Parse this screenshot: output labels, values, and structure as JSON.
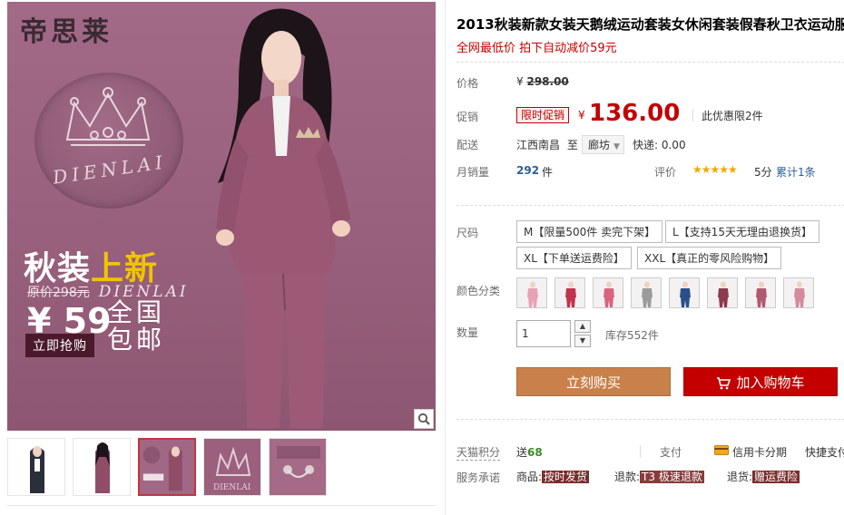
{
  "gallery": {
    "brand": "帝思莱",
    "crown_text": "DIENLAI",
    "promo_title_a": "秋装",
    "promo_title_b": "上新",
    "promo_orig_prefix": "原价298元",
    "promo_orig_en": "DIENLAI",
    "promo_price": "¥ 59",
    "promo_ship": "全国包邮",
    "promo_button": "立即抢购",
    "thumbnails": [
      "thumb-1",
      "thumb-2",
      "thumb-3",
      "thumb-4",
      "thumb-5"
    ],
    "active_thumbnail_index": 2
  },
  "product": {
    "title": "2013秋装新款女装天鹅绒运动套装女休闲套装假春秋卫衣运动服",
    "subtitle": "全网最低价 拍下自动减价59元"
  },
  "price": {
    "label": "价格",
    "currency": "¥",
    "original": "298.00"
  },
  "promo": {
    "label": "促销",
    "badge": "限时促销",
    "currency": "¥",
    "value": "136.00",
    "limit": "此优惠限2件"
  },
  "shipping": {
    "label": "配送",
    "from": "江西南昌",
    "to_word": "至",
    "to": "廊坊",
    "fee": "快递: 0.00"
  },
  "sales": {
    "label": "月销量",
    "count": "292",
    "unit": "件",
    "rating_label": "评价",
    "stars": "★★★★★",
    "score": "5分",
    "total": "累计1条"
  },
  "size": {
    "label": "尺码",
    "options": [
      "M【限量500件 卖完下架】",
      "L【支持15天无理由退换货】",
      "XL【下单送运费险】",
      "XXL【真正的零风险购物】"
    ]
  },
  "colors": {
    "label": "颜色分类",
    "swatches": [
      "#e7a2b6",
      "#c0334f",
      "#d9647f",
      "#9a9a9a",
      "#2a4f8a",
      "#8c3a4e",
      "#b05a70",
      "#d48a9c"
    ]
  },
  "quantity": {
    "label": "数量",
    "value": "1",
    "stock": "库存552件"
  },
  "actions": {
    "buy": "立刻购买",
    "cart": "加入购物车"
  },
  "points": {
    "label": "天猫积分",
    "prefix": "送",
    "value": "68",
    "pay_label": "支付",
    "pay_card": "信用卡分期",
    "pay_fast": "快捷支付"
  },
  "service": {
    "label": "服务承诺",
    "goods_label": "商品:",
    "goods_tag": "按时发货",
    "refund_label": "退款:",
    "refund_tag": "T3 极速退款",
    "return_label": "退货:",
    "return_tag": "赠运费险"
  }
}
